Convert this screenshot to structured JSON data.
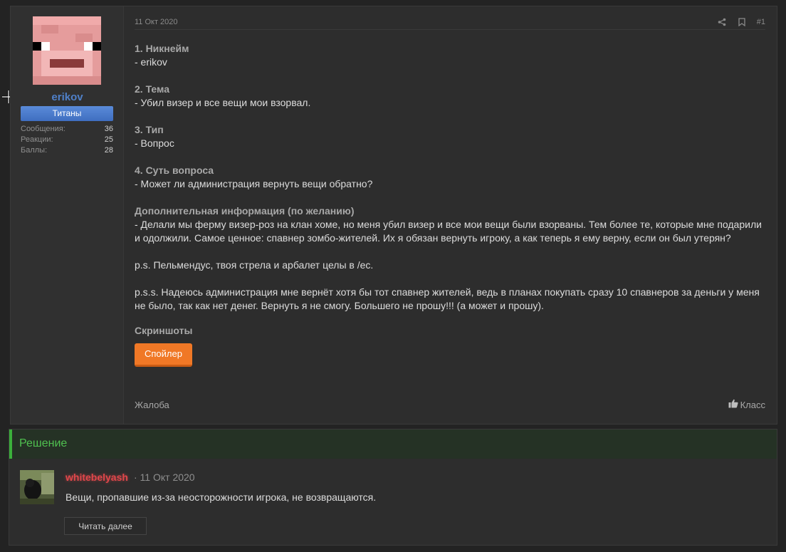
{
  "post": {
    "author": {
      "username": "erikov",
      "rank": "Титаны",
      "stats": [
        {
          "label": "Сообщения:",
          "value": "36"
        },
        {
          "label": "Реакции:",
          "value": "25"
        },
        {
          "label": "Баллы:",
          "value": "28"
        }
      ]
    },
    "date": "11 Окт 2020",
    "number": "#1",
    "questions": [
      {
        "title": "1. Никнейм",
        "lines": [
          "- erikov"
        ]
      },
      {
        "title": "2. Тема",
        "lines": [
          "- Убил визер и все вещи мои взорвал."
        ]
      },
      {
        "title": "3. Тип",
        "lines": [
          "- Вопрос"
        ]
      },
      {
        "title": "4. Суть вопроса",
        "lines": [
          "- Может ли администрация вернуть вещи обратно?"
        ]
      },
      {
        "title": "Дополнительная информация (по желанию)",
        "lines": [
          "- Делали мы ферму визер-роз на клан хоме, но меня убил визер и все мои вещи были взорваны. Тем более те, которые мне подарили и одолжили. Самое ценное: спавнер зомбо-жителей. Их я обязан вернуть игроку, а как теперь я ему верну, если он был утерян?"
        ]
      },
      {
        "title": "",
        "lines": [
          "p.s. Пельмендус, твоя стрела и арбалет целы в /ec."
        ]
      },
      {
        "title": "",
        "lines": [
          "p.s.s. Надеюсь администрация мне вернёт хотя бы тот спавнер жителей, ведь в планах покупать сразу 10 спавнеров за деньги у меня не было, так как нет денег. Вернуть я не смогу. Большего не прошу!!! (а может и прошу)."
        ]
      }
    ],
    "screenshots_title": "Скриншоты",
    "spoiler_label": "Спойлер",
    "report_label": "Жалоба",
    "like_label": "Класс",
    "icons": {
      "share": "share-icon",
      "bookmark": "bookmark-icon",
      "like": "thumbs-up-icon"
    }
  },
  "solution": {
    "title": "Решение",
    "author": "whitebelyash",
    "meta": "· 11 Окт 2020",
    "text": "Вещи, пропавшие из-за неосторожности игрока, не возвращаются.",
    "read_more": "Читать далее"
  },
  "colors": {
    "accent_blue": "#4f80c9",
    "spoiler_orange": "#f07826",
    "solution_green": "#3bb03b",
    "author_red": "#e0474b"
  }
}
